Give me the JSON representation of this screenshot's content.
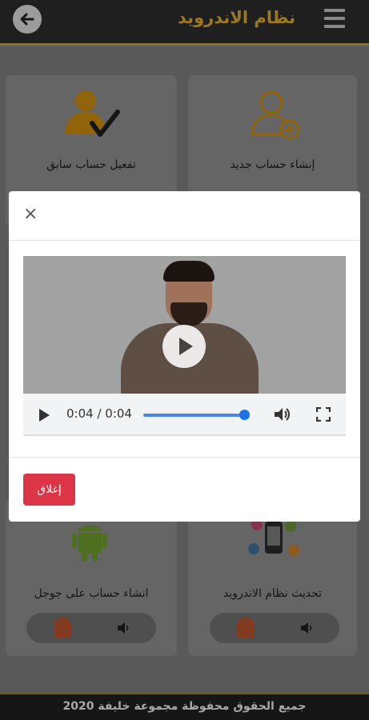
{
  "header": {
    "title": "نظام الاندرويد"
  },
  "cards": [
    {
      "label": "إنشاء حساب جديد",
      "icon": "add-user-icon"
    },
    {
      "label": "تفعيل حساب سابق",
      "icon": "user-check-icon"
    },
    {
      "label": "تحديث نظام الاندرويد",
      "icon": "phone-apps-icon"
    },
    {
      "label": "انشاء حساب على جوجل",
      "icon": "android-icon"
    }
  ],
  "modal": {
    "close_symbol": "×",
    "video": {
      "time": "0:04 / 0:04",
      "progress": 1.0
    },
    "close_button": "إغلاق"
  },
  "footer": {
    "text": "جميع الحقوق محفوظة مجموعة خليفة 2020"
  },
  "colors": {
    "header_bg": "#2b2b2b",
    "title": "#d9a72b",
    "close_button": "#dc3545",
    "icon_accent": "#e3a21a"
  }
}
